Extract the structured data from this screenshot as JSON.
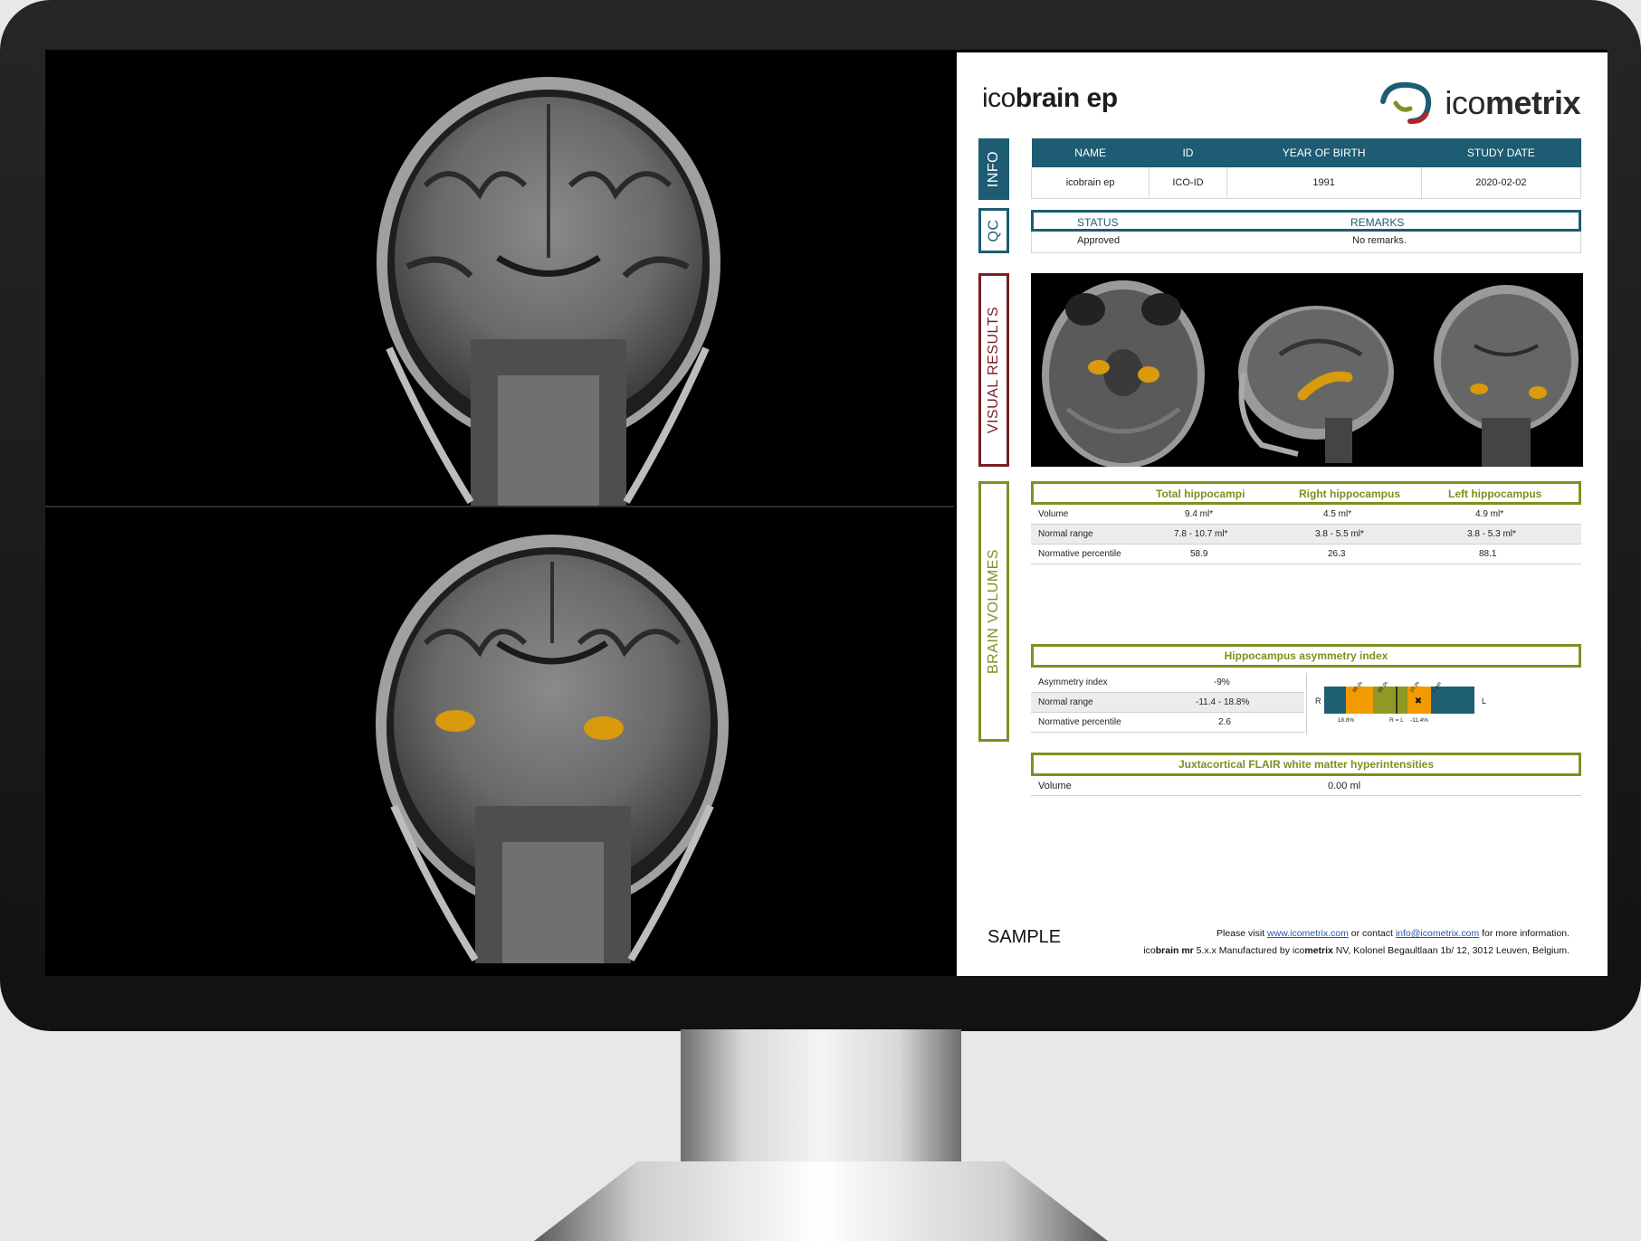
{
  "report": {
    "product_prefix": "ico",
    "product_name": "brain ep",
    "logo_prefix": "ico",
    "logo_name": "metrix",
    "sections": {
      "info": "INFO",
      "qc": "QC",
      "visual": "VISUAL RESULTS",
      "brain": "BRAIN VOLUMES"
    },
    "info_table": {
      "headers": [
        "NAME",
        "ID",
        "YEAR OF BIRTH",
        "STUDY DATE"
      ],
      "values": [
        "icobrain ep",
        "ICO-ID",
        "1991",
        "2020-02-02"
      ]
    },
    "qc": {
      "status_header": "STATUS",
      "remarks_header": "REMARKS",
      "status": "Approved",
      "remarks": "No remarks."
    },
    "volumes": {
      "headers": [
        "Total  hippocampi",
        "Right hippocampus",
        "Left hippocampus"
      ],
      "rows": [
        {
          "label": "Volume",
          "values": [
            "9.4 ml*",
            "4.5 ml*",
            "4.9 ml*"
          ]
        },
        {
          "label": "Normal range",
          "values": [
            "7.8 - 10.7 ml*",
            "3.8 - 5.5 ml*",
            "3.8 - 5.3 ml*"
          ]
        },
        {
          "label": "Normative percentile",
          "values": [
            "58.9",
            "26.3",
            "88.1"
          ]
        }
      ]
    },
    "asymmetry": {
      "title": "Hippocampus asymmetry index",
      "rows": [
        {
          "label": "Asymmetry index",
          "value": "-9%"
        },
        {
          "label": "Normal range",
          "value": "-11.4 - 18.8%"
        },
        {
          "label": "Normative percentile",
          "value": "2.6"
        }
      ],
      "gauge": {
        "left_label": "R",
        "right_label": "L",
        "center_label": "R = L",
        "tick_left": "18.8%",
        "tick_right": "-11.4%",
        "band_labels": [
          "99 perc.",
          "90 perc.",
          "10 perc.",
          "1 perc."
        ],
        "marker": "✖",
        "marker_value": -9,
        "colors": {
          "outer": "#1f5f74",
          "mid": "#f29b00",
          "inner": "#8e9a24"
        }
      }
    },
    "flair": {
      "title": "Juxtacortical FLAIR white matter hyperintensities",
      "label": "Volume",
      "value": "0.00 ml"
    },
    "sample": "SAMPLE",
    "footer": {
      "visit": "Please visit ",
      "website": "www.icometrix.com",
      "contact": " or contact ",
      "email": "info@icometrix.com",
      "more": " for more information.",
      "product_prefix": "ico",
      "product_bold": "brain mr",
      "manufacture_text": " 5.x.x Manufactured by ",
      "company_prefix": "ico",
      "company_bold": "metrix",
      "address": " NV, Kolonel Begaultlaan 1b/ 12, 3012 Leuven, Belgium."
    }
  },
  "colors": {
    "info_blue": "#1d5c72",
    "visual_red": "#7a1f22",
    "brain_olive": "#7f8f22",
    "segmentation_orange": "#d99a0c"
  }
}
